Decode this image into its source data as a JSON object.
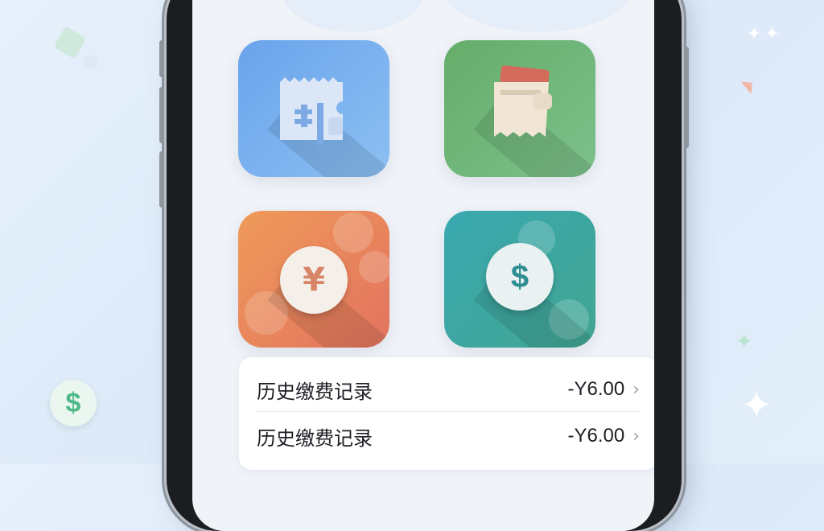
{
  "app": {
    "tiles": [
      {
        "name": "receipt-ticket-tile",
        "icon": "ticket-icon",
        "color": "#6fa5e8"
      },
      {
        "name": "bill-scroll-tile",
        "icon": "scroll-bill-icon",
        "color": "#6cb471"
      },
      {
        "name": "yuan-payment-tile",
        "icon": "yuan-coin-icon",
        "color": "#e98a5a"
      },
      {
        "name": "dollar-payment-tile",
        "icon": "dollar-coin-icon",
        "color": "#3fa5a3"
      }
    ],
    "records": [
      {
        "label": "历史缴费记录",
        "amount": "-Y6.00",
        "chevron": "›"
      },
      {
        "label": "历史缴费记录",
        "amount": "-Y6.00",
        "chevron": "›"
      }
    ]
  },
  "colors": {
    "background": "#e3edf9",
    "phone_frame": "#1b1d21",
    "screen": "#f0f3f8",
    "text": "#1d1f24"
  }
}
